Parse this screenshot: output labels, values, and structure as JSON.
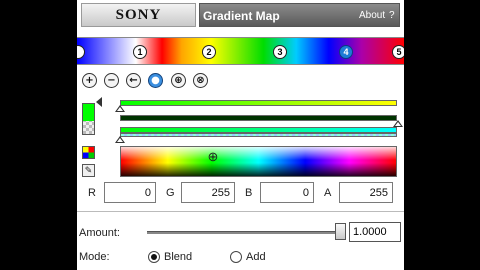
{
  "header": {
    "logo": "SONY",
    "title": "Gradient Map",
    "about_label": "About",
    "help_label": "?"
  },
  "gradient": {
    "stops": [
      "1",
      "2",
      "3",
      "4",
      "5"
    ],
    "selected_stop": "4"
  },
  "toolbar": {
    "icons": [
      "add-stop-icon",
      "remove-stop-icon",
      "move-left-icon",
      "select-stop-icon",
      "spread-stops-icon",
      "distribute-stops-icon"
    ],
    "glyphs": [
      "+",
      "−",
      "←",
      "●",
      "⊕",
      "⊗"
    ]
  },
  "color": {
    "current": "#00ff00",
    "r": "0",
    "g": "255",
    "b": "0",
    "a": "255",
    "labels": {
      "r": "R",
      "g": "G",
      "b": "B",
      "a": "A"
    }
  },
  "amount": {
    "label": "Amount:",
    "value": "1.0000"
  },
  "mode": {
    "label": "Mode:",
    "options": [
      "Blend",
      "Add"
    ],
    "selected": "Blend"
  }
}
